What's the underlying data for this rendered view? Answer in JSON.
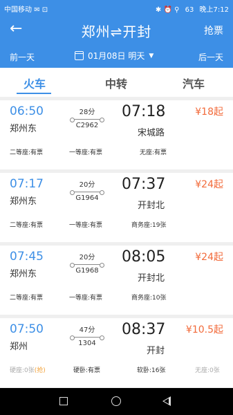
{
  "statusbar": {
    "carrier": "中国移动",
    "icons": "✉ ⊡",
    "right_icons": "✱ ⏰ ⚲",
    "battery": "63",
    "time": "晚上7:12"
  },
  "header": {
    "back_icon": "←",
    "title": "郑州⇌开封",
    "action": "抢票"
  },
  "datebar": {
    "prev": "前一天",
    "date": "01月08日 明天",
    "next": "后一天"
  },
  "tabs": [
    {
      "label": "火车",
      "active": true
    },
    {
      "label": "中转",
      "active": false
    },
    {
      "label": "汽车",
      "active": false
    }
  ],
  "trains": [
    {
      "depart_time": "06:50",
      "depart_station": "郑州东",
      "duration": "28分",
      "train_no": "C2962",
      "arrive_time": "07:18",
      "arrive_station": "宋城路",
      "price": "¥18起",
      "seats": [
        "二等座:有票",
        "一等座:有票",
        "无座:有票"
      ]
    },
    {
      "depart_time": "07:17",
      "depart_station": "郑州东",
      "duration": "20分",
      "train_no": "G1964",
      "arrive_time": "07:37",
      "arrive_station": "开封北",
      "price": "¥24起",
      "seats": [
        "二等座:有票",
        "一等座:有票",
        "商务座:19张"
      ]
    },
    {
      "depart_time": "07:45",
      "depart_station": "郑州东",
      "duration": "20分",
      "train_no": "G1968",
      "arrive_time": "08:05",
      "arrive_station": "开封北",
      "price": "¥24起",
      "seats": [
        "二等座:有票",
        "一等座:有票",
        "商务座:10张"
      ]
    },
    {
      "depart_time": "07:50",
      "depart_station": "郑州",
      "duration": "47分",
      "train_no": "1304",
      "arrive_time": "08:37",
      "arrive_station": "开封",
      "price": "¥10.5起",
      "seats": [
        "硬座:0张",
        "硬卧:有票",
        "软卧:16张",
        "无座:0张"
      ],
      "grab_label": "(抢)"
    }
  ],
  "colors": {
    "accent": "#3d8fe6",
    "price": "#f26a3a"
  }
}
